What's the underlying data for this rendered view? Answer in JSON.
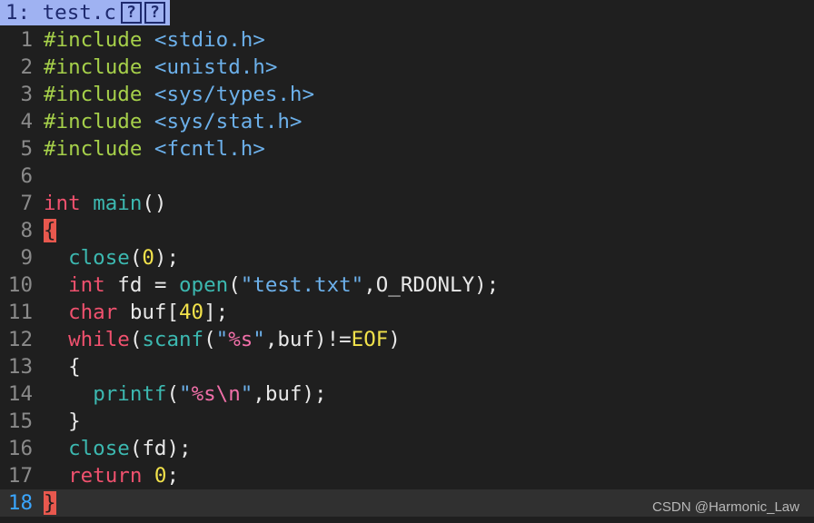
{
  "tabline": {
    "active_tab_label": "1: test.c",
    "indicator_1": "?",
    "indicator_2": "?"
  },
  "editor": {
    "lines": [
      {
        "number": "1",
        "tokens": [
          {
            "t": "#include ",
            "c": "pre"
          },
          {
            "t": "<stdio.h>",
            "c": "inc"
          }
        ]
      },
      {
        "number": "2",
        "tokens": [
          {
            "t": "#include ",
            "c": "pre"
          },
          {
            "t": "<unistd.h>",
            "c": "inc"
          }
        ]
      },
      {
        "number": "3",
        "tokens": [
          {
            "t": "#include ",
            "c": "pre"
          },
          {
            "t": "<sys/types.h>",
            "c": "inc"
          }
        ]
      },
      {
        "number": "4",
        "tokens": [
          {
            "t": "#include ",
            "c": "pre"
          },
          {
            "t": "<sys/stat.h>",
            "c": "inc"
          }
        ]
      },
      {
        "number": "5",
        "tokens": [
          {
            "t": "#include ",
            "c": "pre"
          },
          {
            "t": "<fcntl.h>",
            "c": "inc"
          }
        ]
      },
      {
        "number": "6",
        "tokens": []
      },
      {
        "number": "7",
        "tokens": [
          {
            "t": "int",
            "c": "kw"
          },
          {
            "t": " ",
            "c": "punct"
          },
          {
            "t": "main",
            "c": "fn"
          },
          {
            "t": "()",
            "c": "punct"
          }
        ]
      },
      {
        "number": "8",
        "tokens": [
          {
            "t": "{",
            "c": "brace-hl"
          }
        ]
      },
      {
        "number": "9",
        "tokens": [
          {
            "t": "  ",
            "c": "punct"
          },
          {
            "t": "close",
            "c": "fn"
          },
          {
            "t": "(",
            "c": "punct"
          },
          {
            "t": "0",
            "c": "num"
          },
          {
            "t": ");",
            "c": "punct"
          }
        ]
      },
      {
        "number": "10",
        "tokens": [
          {
            "t": "  ",
            "c": "punct"
          },
          {
            "t": "int",
            "c": "kw"
          },
          {
            "t": " fd = ",
            "c": "punct"
          },
          {
            "t": "open",
            "c": "fn"
          },
          {
            "t": "(",
            "c": "punct"
          },
          {
            "t": "\"test.txt\"",
            "c": "str"
          },
          {
            "t": ",O_RDONLY);",
            "c": "punct"
          }
        ]
      },
      {
        "number": "11",
        "tokens": [
          {
            "t": "  ",
            "c": "punct"
          },
          {
            "t": "char",
            "c": "kw"
          },
          {
            "t": " buf[",
            "c": "punct"
          },
          {
            "t": "40",
            "c": "num"
          },
          {
            "t": "];",
            "c": "punct"
          }
        ]
      },
      {
        "number": "12",
        "tokens": [
          {
            "t": "  ",
            "c": "punct"
          },
          {
            "t": "while",
            "c": "kw"
          },
          {
            "t": "(",
            "c": "punct"
          },
          {
            "t": "scanf",
            "c": "fn"
          },
          {
            "t": "(",
            "c": "punct"
          },
          {
            "t": "\"",
            "c": "str"
          },
          {
            "t": "%s",
            "c": "fmt"
          },
          {
            "t": "\"",
            "c": "str"
          },
          {
            "t": ",buf)!=",
            "c": "punct"
          },
          {
            "t": "EOF",
            "c": "const"
          },
          {
            "t": ")",
            "c": "punct"
          }
        ]
      },
      {
        "number": "13",
        "tokens": [
          {
            "t": "  {",
            "c": "punct"
          }
        ]
      },
      {
        "number": "14",
        "tokens": [
          {
            "t": "    ",
            "c": "punct"
          },
          {
            "t": "printf",
            "c": "fn"
          },
          {
            "t": "(",
            "c": "punct"
          },
          {
            "t": "\"",
            "c": "str"
          },
          {
            "t": "%s\\n",
            "c": "fmt"
          },
          {
            "t": "\"",
            "c": "str"
          },
          {
            "t": ",buf);",
            "c": "punct"
          }
        ]
      },
      {
        "number": "15",
        "tokens": [
          {
            "t": "  }",
            "c": "punct"
          }
        ]
      },
      {
        "number": "16",
        "tokens": [
          {
            "t": "  ",
            "c": "punct"
          },
          {
            "t": "close",
            "c": "fn"
          },
          {
            "t": "(fd);",
            "c": "punct"
          }
        ]
      },
      {
        "number": "17",
        "tokens": [
          {
            "t": "  ",
            "c": "punct"
          },
          {
            "t": "return",
            "c": "kw"
          },
          {
            "t": " ",
            "c": "punct"
          },
          {
            "t": "0",
            "c": "num"
          },
          {
            "t": ";",
            "c": "punct"
          }
        ]
      },
      {
        "number": "18",
        "tokens": [
          {
            "t": "}",
            "c": "brace-hl"
          }
        ],
        "current": true
      }
    ]
  },
  "watermark": "CSDN @Harmonic_Law",
  "colors": {
    "background": "#1f1f1f",
    "tab_active_bg": "#9fb2f2",
    "preproc": "#a6d04a",
    "include_path": "#6cb0ea",
    "keyword": "#f0516e",
    "function": "#3cb8b0",
    "number": "#f2e24b",
    "format_spec": "#f06fa8",
    "brace_match_bg": "#e8584e",
    "current_line_number": "#3aa6ff"
  }
}
